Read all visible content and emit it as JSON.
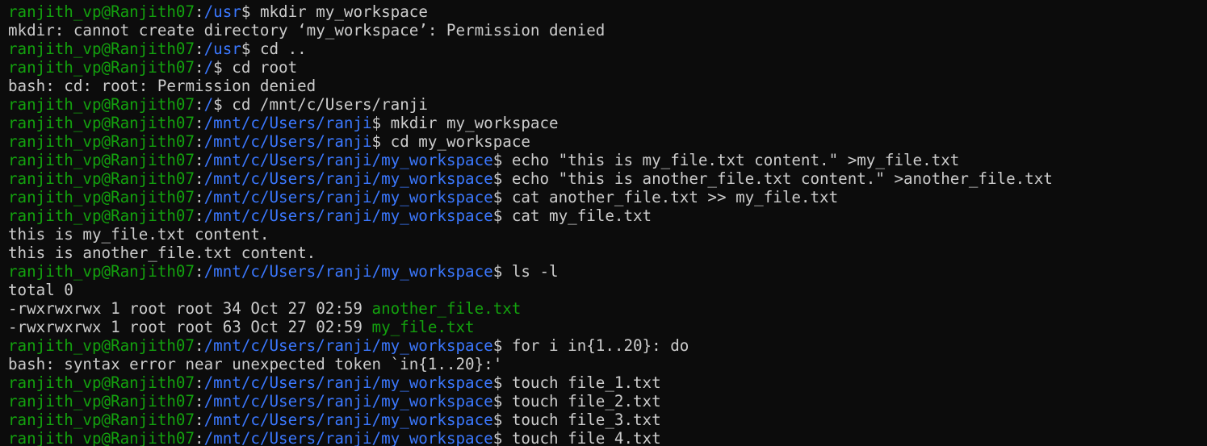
{
  "colors": {
    "background": "#0c0c0c",
    "text": "#cccccc",
    "user_host": "#13a10e",
    "path": "#3b78ff",
    "ls_file": "#13a10e"
  },
  "lines": [
    {
      "type": "prompt",
      "user": "ranjith_vp@Ranjith07",
      "sep": ":",
      "path": "/usr",
      "dollar": "$ ",
      "cmd": "mkdir my_workspace"
    },
    {
      "type": "output",
      "text": "mkdir: cannot create directory ‘my_workspace’: Permission denied"
    },
    {
      "type": "prompt",
      "user": "ranjith_vp@Ranjith07",
      "sep": ":",
      "path": "/usr",
      "dollar": "$ ",
      "cmd": "cd .."
    },
    {
      "type": "prompt",
      "user": "ranjith_vp@Ranjith07",
      "sep": ":",
      "path": "/",
      "dollar": "$ ",
      "cmd": "cd root"
    },
    {
      "type": "output",
      "text": "bash: cd: root: Permission denied"
    },
    {
      "type": "prompt",
      "user": "ranjith_vp@Ranjith07",
      "sep": ":",
      "path": "/",
      "dollar": "$ ",
      "cmd": "cd /mnt/c/Users/ranji"
    },
    {
      "type": "prompt",
      "user": "ranjith_vp@Ranjith07",
      "sep": ":",
      "path": "/mnt/c/Users/ranji",
      "dollar": "$ ",
      "cmd": "mkdir my_workspace"
    },
    {
      "type": "prompt",
      "user": "ranjith_vp@Ranjith07",
      "sep": ":",
      "path": "/mnt/c/Users/ranji",
      "dollar": "$ ",
      "cmd": "cd my_workspace"
    },
    {
      "type": "prompt",
      "user": "ranjith_vp@Ranjith07",
      "sep": ":",
      "path": "/mnt/c/Users/ranji/my_workspace",
      "dollar": "$ ",
      "cmd": "echo \"this is my_file.txt content.\" >my_file.txt"
    },
    {
      "type": "prompt",
      "user": "ranjith_vp@Ranjith07",
      "sep": ":",
      "path": "/mnt/c/Users/ranji/my_workspace",
      "dollar": "$ ",
      "cmd": "echo \"this is another_file.txt content.\" >another_file.txt"
    },
    {
      "type": "prompt",
      "user": "ranjith_vp@Ranjith07",
      "sep": ":",
      "path": "/mnt/c/Users/ranji/my_workspace",
      "dollar": "$ ",
      "cmd": "cat another_file.txt >> my_file.txt"
    },
    {
      "type": "prompt",
      "user": "ranjith_vp@Ranjith07",
      "sep": ":",
      "path": "/mnt/c/Users/ranji/my_workspace",
      "dollar": "$ ",
      "cmd": "cat my_file.txt"
    },
    {
      "type": "output",
      "text": "this is my_file.txt content."
    },
    {
      "type": "output",
      "text": "this is another_file.txt content."
    },
    {
      "type": "prompt",
      "user": "ranjith_vp@Ranjith07",
      "sep": ":",
      "path": "/mnt/c/Users/ranji/my_workspace",
      "dollar": "$ ",
      "cmd": "ls -l"
    },
    {
      "type": "output",
      "text": "total 0"
    },
    {
      "type": "ls",
      "text": "-rwxrwxrwx 1 root root 34 Oct 27 02:59 ",
      "file": "another_file.txt"
    },
    {
      "type": "ls",
      "text": "-rwxrwxrwx 1 root root 63 Oct 27 02:59 ",
      "file": "my_file.txt"
    },
    {
      "type": "prompt",
      "user": "ranjith_vp@Ranjith07",
      "sep": ":",
      "path": "/mnt/c/Users/ranji/my_workspace",
      "dollar": "$ ",
      "cmd": "for i in{1..20}: do"
    },
    {
      "type": "output",
      "text": "bash: syntax error near unexpected token `in{1..20}:'"
    },
    {
      "type": "prompt",
      "user": "ranjith_vp@Ranjith07",
      "sep": ":",
      "path": "/mnt/c/Users/ranji/my_workspace",
      "dollar": "$ ",
      "cmd": "touch file_1.txt"
    },
    {
      "type": "prompt",
      "user": "ranjith_vp@Ranjith07",
      "sep": ":",
      "path": "/mnt/c/Users/ranji/my_workspace",
      "dollar": "$ ",
      "cmd": "touch file_2.txt"
    },
    {
      "type": "prompt",
      "user": "ranjith_vp@Ranjith07",
      "sep": ":",
      "path": "/mnt/c/Users/ranji/my_workspace",
      "dollar": "$ ",
      "cmd": "touch file_3.txt"
    },
    {
      "type": "prompt",
      "user": "ranjith_vp@Ranjith07",
      "sep": ":",
      "path": "/mnt/c/Users/ranji/my_workspace",
      "dollar": "$ ",
      "cmd": "touch file_4.txt"
    }
  ]
}
